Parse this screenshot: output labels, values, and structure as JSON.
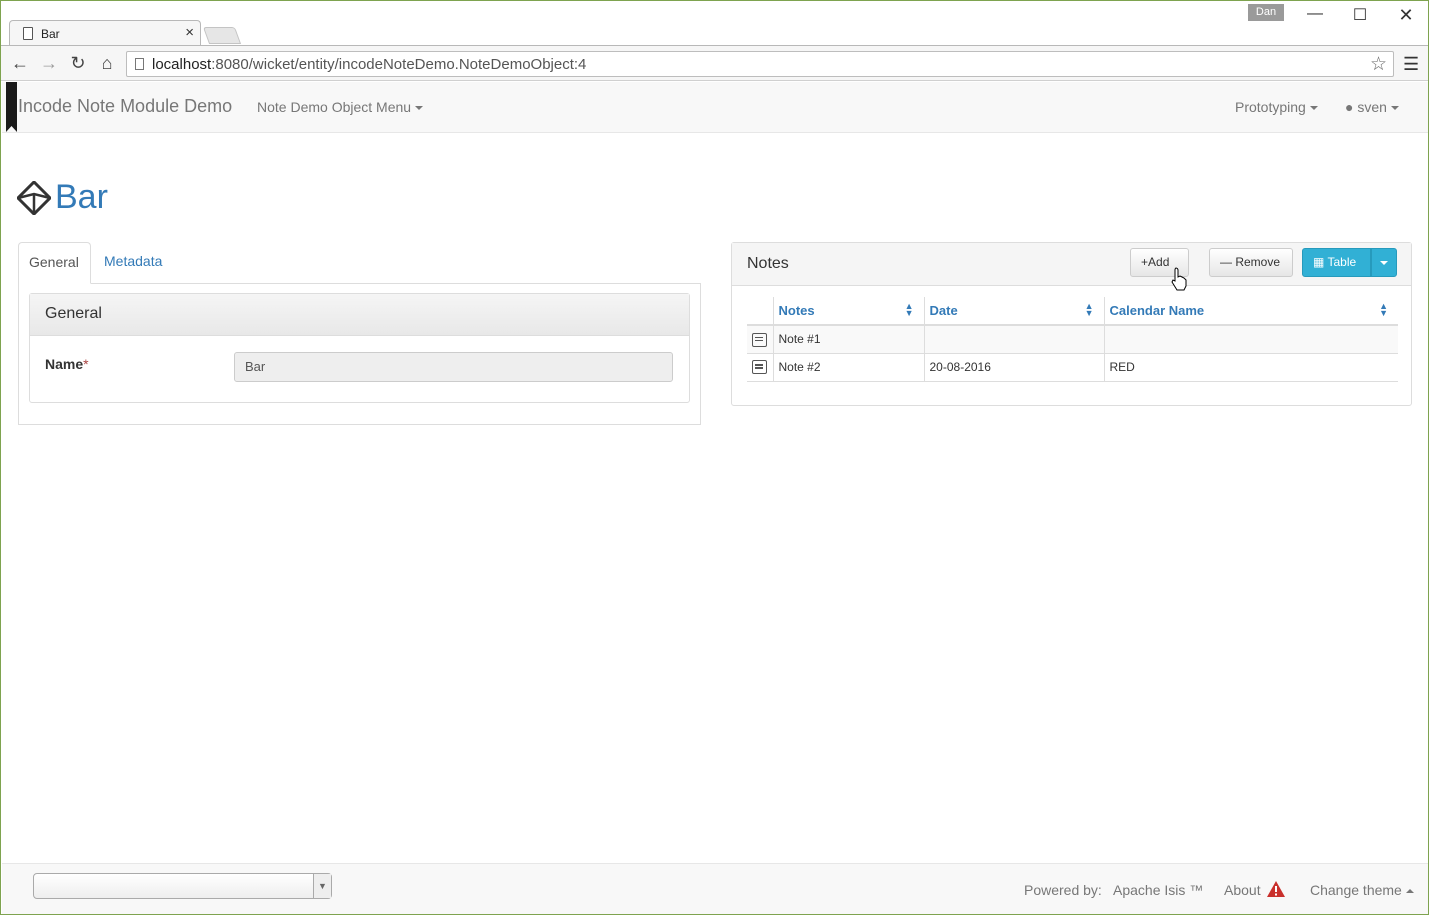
{
  "browser": {
    "tab_title": "Bar",
    "tab_close": "×",
    "profile_badge": "Dan",
    "url_host": "localhost",
    "url_rest": ":8080/wicket/entity/incodeNoteDemo.NoteDemoObject:4"
  },
  "navbar": {
    "brand": "Incode Note Module Demo",
    "menu": "Note Demo Object Menu",
    "prototyping": "Prototyping",
    "user": "sven"
  },
  "entity": {
    "title": "Bar",
    "tabs": [
      "General",
      "Metadata"
    ],
    "fieldset_title": "General",
    "name_label": "Name",
    "required_mark": "*",
    "name_value": "Bar"
  },
  "notes": {
    "panel_title": "Notes",
    "add_label": "Add",
    "remove_label": "Remove",
    "table_label": "Table",
    "columns": [
      "Notes",
      "Date",
      "Calendar Name"
    ],
    "rows": [
      {
        "notes": "Note #1",
        "date": "",
        "calendar": ""
      },
      {
        "notes": "Note #2",
        "date": "20-08-2016",
        "calendar": "RED"
      }
    ]
  },
  "footer": {
    "powered_by": "Powered by:",
    "isis": "Apache Isis ™",
    "about": "About",
    "change_theme": "Change theme"
  },
  "colors": {
    "link": "#337ab7",
    "table_button": "#31b0d5",
    "warning": "#c9302c"
  },
  "icons": [
    "page-icon",
    "close-icon",
    "back-icon",
    "forward-icon",
    "reload-icon",
    "home-icon",
    "star-icon",
    "menu-icon",
    "cube-icon",
    "user-icon",
    "plus-icon",
    "minus-icon",
    "table-icon",
    "sort-icon",
    "note-icon",
    "warning-icon"
  ]
}
